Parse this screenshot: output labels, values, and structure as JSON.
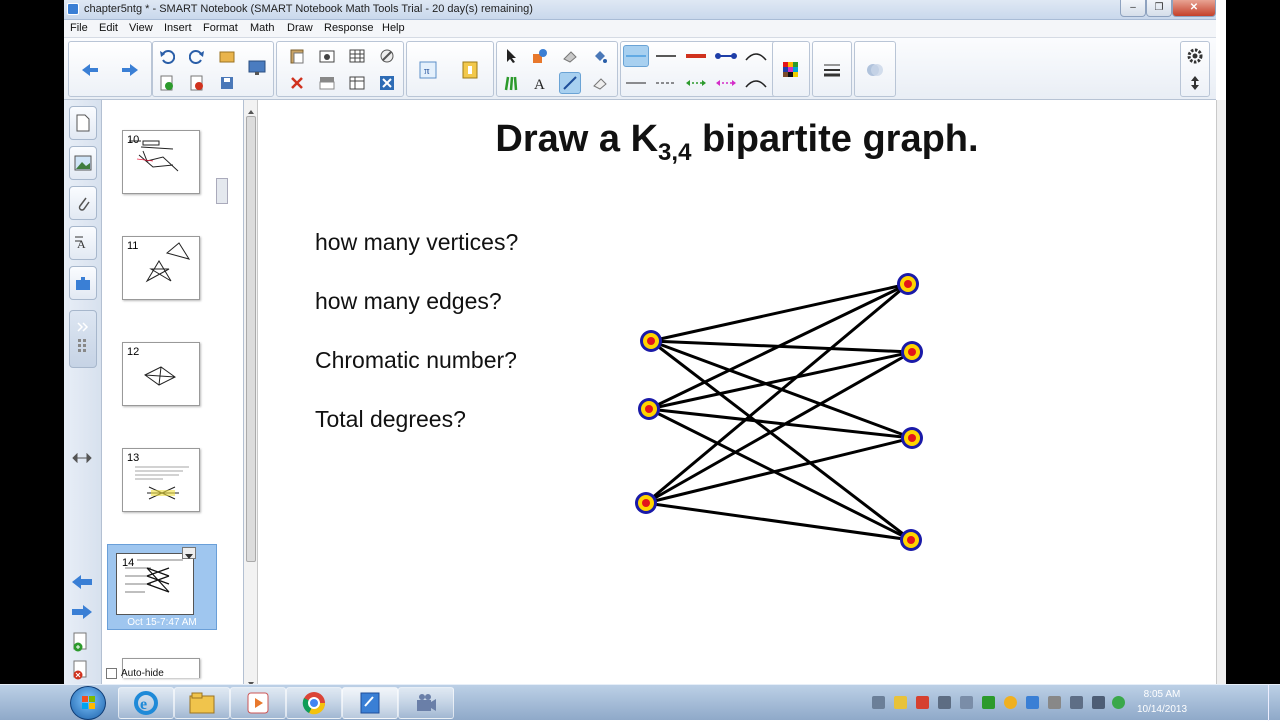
{
  "window": {
    "title": "chapter5ntg * - SMART Notebook (SMART Notebook Math Tools Trial - 20 day(s) remaining)"
  },
  "menu": [
    "File",
    "Edit",
    "View",
    "Insert",
    "Format",
    "Math",
    "Draw",
    "Response",
    "Help"
  ],
  "sidebar": {
    "autohide_label": "Auto-hide"
  },
  "thumbnails": [
    {
      "num": "10"
    },
    {
      "num": "11"
    },
    {
      "num": "12"
    },
    {
      "num": "13"
    },
    {
      "num": "14",
      "caption": "Oct 15-7:47 AM"
    }
  ],
  "slide": {
    "title_main": "Draw a K",
    "title_sub": "3,4",
    "title_rest": " bipartite graph.",
    "questions": [
      "how many vertices?",
      "how many edges?",
      "Chromatic number?",
      "Total degrees?"
    ]
  },
  "graph": {
    "left_vertices": 3,
    "right_vertices": 4
  },
  "taskbar": {
    "time": "8:05 AM",
    "date": "10/14/2013"
  },
  "colors": {
    "vertex_ring": "#1a1aa8",
    "vertex_fill": "#ffd400",
    "vertex_center": "#e3141b",
    "pen_active": "#a8d0f0"
  }
}
